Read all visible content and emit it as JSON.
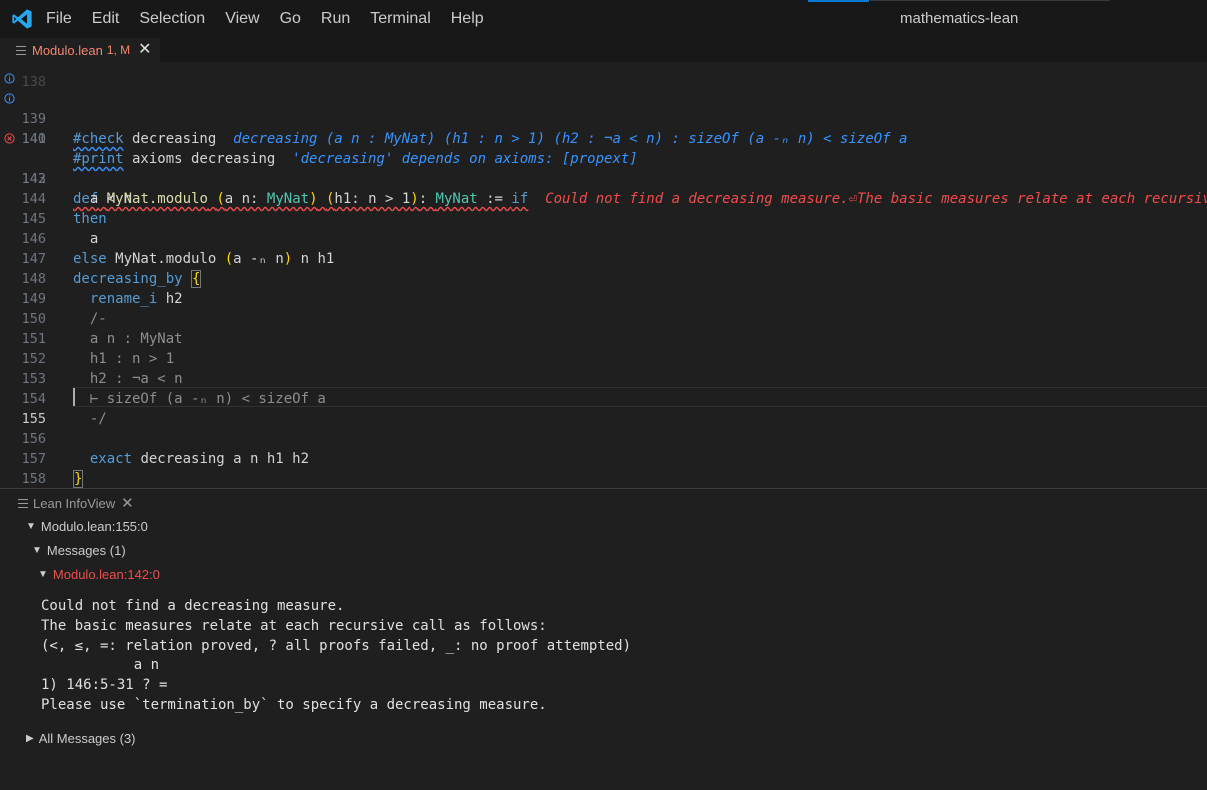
{
  "menu": [
    "File",
    "Edit",
    "Selection",
    "View",
    "Go",
    "Run",
    "Terminal",
    "Help"
  ],
  "window_title": "mathematics-lean",
  "tab": {
    "label": "Modulo.lean",
    "status": "1, M"
  },
  "editor": {
    "lines": [
      {
        "num": "139",
        "gutter": "info"
      },
      {
        "num": "140",
        "gutter": "info"
      },
      {
        "num": "141"
      },
      {
        "num": "142",
        "gutter": "error"
      },
      {
        "num": "143"
      },
      {
        "num": "144"
      },
      {
        "num": "145"
      },
      {
        "num": "146"
      },
      {
        "num": "147"
      },
      {
        "num": "148"
      },
      {
        "num": "149"
      },
      {
        "num": "150"
      },
      {
        "num": "151"
      },
      {
        "num": "152"
      },
      {
        "num": "153"
      },
      {
        "num": "154"
      },
      {
        "num": "155",
        "active": true
      },
      {
        "num": "156"
      },
      {
        "num": "157"
      },
      {
        "num": "158"
      }
    ],
    "inlay_139": "decreasing (a n : MyNat) (h1 : n > 1) (h2 : ¬a < n) : sizeOf (a -ₙ n) < sizeOf a",
    "inlay_140": "'decreasing' depends on axioms: [propext]",
    "inlay_142": "Could not find a decreasing measure.⏎The basic measures relate at each recursive call as follows:"
  },
  "infoview": {
    "title": "Lean InfoView",
    "position": "Modulo.lean:155:0",
    "messages_header": "Messages (1)",
    "message_location": "Modulo.lean:142:0",
    "message_text": "Could not find a decreasing measure.\nThe basic measures relate at each recursive call as follows:\n(<, ≤, =: relation proved, ? all proofs failed, _: no proof attempted)\n           a n\n1) 146:5-31 ? =\nPlease use `termination_by` to specify a decreasing measure.",
    "all_messages": "All Messages (3)"
  },
  "colors": {
    "error": "#f14c4c",
    "info": "#3794ff",
    "keyword": "#569cd6",
    "type": "#4ec9b0",
    "function": "#dcdcaa",
    "bracket": "#ffd700",
    "accent": "#0078d4"
  }
}
